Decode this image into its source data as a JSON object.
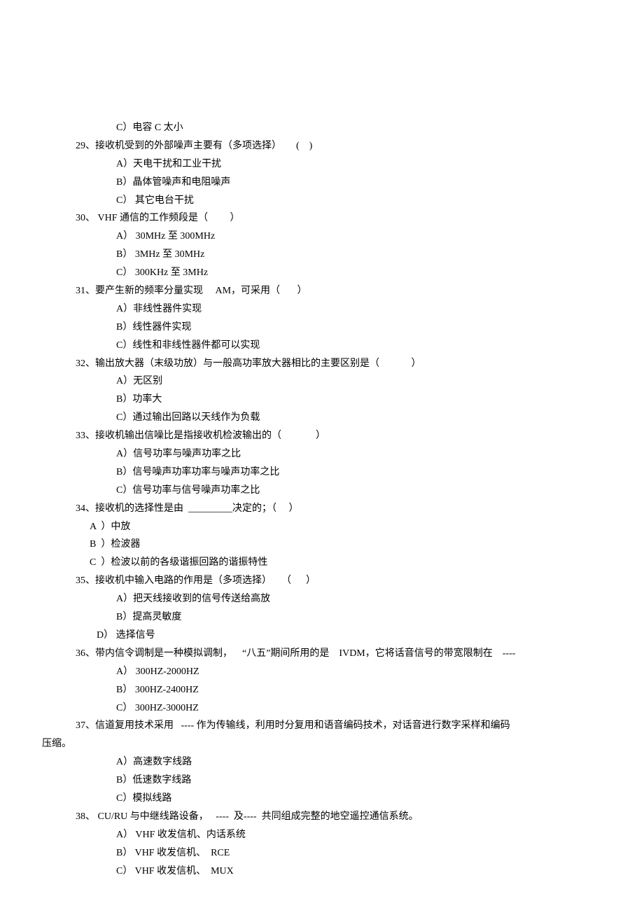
{
  "lines": [
    {
      "cls": "option",
      "text": "C）电容 C 太小"
    },
    {
      "cls": "question",
      "text": "29、接收机受到的外部噪声主要有（多项选择）      (    )"
    },
    {
      "cls": "option",
      "text": "A）天电干扰和工业干扰"
    },
    {
      "cls": "option",
      "text": "B）晶体管噪声和电阻噪声"
    },
    {
      "cls": "option",
      "text": "C） 其它电台干扰"
    },
    {
      "cls": "question",
      "text": "30、 VHF 通信的工作频段是（         ）"
    },
    {
      "cls": "option",
      "text": "A） 30MHz 至 300MHz"
    },
    {
      "cls": "option",
      "text": "B） 3MHz 至 30MHz"
    },
    {
      "cls": "option",
      "text": "C） 300KHz 至 3MHz"
    },
    {
      "cls": "question",
      "text": "31、要产生新的频率分量实现     AM，可采用（       ）"
    },
    {
      "cls": "option",
      "text": "A）非线性器件实现"
    },
    {
      "cls": "option",
      "text": "B）线性器件实现"
    },
    {
      "cls": "option",
      "text": "C）线性和非线性器件都可以实现"
    },
    {
      "cls": "question",
      "text": "32、输出放大器（末级功放）与一般高功率放大器相比的主要区别是（             ）"
    },
    {
      "cls": "option",
      "text": "A）无区别"
    },
    {
      "cls": "option",
      "text": "B）功率大"
    },
    {
      "cls": "option",
      "text": "C）通过输出回路以天线作为负载"
    },
    {
      "cls": "question",
      "text": "33、接收机输出信噪比是指接收机检波输出的（              ）"
    },
    {
      "cls": "option",
      "text": "A）信号功率与噪声功率之比"
    },
    {
      "cls": "option",
      "text": "B）信号噪声功率功率与噪声功率之比"
    },
    {
      "cls": "option",
      "text": "C）信号功率与信号噪声功率之比"
    },
    {
      "cls": "question",
      "text": "34、接收机的选择性是由  _________决定的；（     ）"
    },
    {
      "cls": "option near",
      "text": "A  ）中放"
    },
    {
      "cls": "option near",
      "text": "B  ）检波器"
    },
    {
      "cls": "option near",
      "text": "C  ）检波以前的各级谐振回路的谐振特性"
    },
    {
      "cls": "question",
      "text": "35、接收机中输入电路的作用是（多项选择）    （      ）"
    },
    {
      "cls": "option",
      "text": "A）把天线接收到的信号传送给高放"
    },
    {
      "cls": "option",
      "text": "B）提高灵敏度"
    },
    {
      "cls": "option nearer",
      "text": "D） 选择信号"
    },
    {
      "cls": "question",
      "text": "36、带内信令调制是一种模拟调制，    “八五”期间所用的是    IVDM，它将话音信号的带宽限制在    ----"
    },
    {
      "cls": "option",
      "text": "A） 300HZ-2000HZ"
    },
    {
      "cls": "option",
      "text": "B） 300HZ-2400HZ"
    },
    {
      "cls": "option",
      "text": "C） 300HZ-3000HZ"
    },
    {
      "cls": "question",
      "text": "37、信道复用技术采用   ---- 作为传输线，利用时分复用和语音编码技术，对话音进行数字采样和编码"
    },
    {
      "cls": "continuation",
      "text": "压缩。"
    },
    {
      "cls": "option",
      "text": "A）高速数字线路"
    },
    {
      "cls": "option",
      "text": "B）低速数字线路"
    },
    {
      "cls": "option",
      "text": "C）模拟线路"
    },
    {
      "cls": "question",
      "text": "38、 CU/RU 与中继线路设备，   ----  及----  共同组成完整的地空遥控通信系统。"
    },
    {
      "cls": "option",
      "text": "A） VHF 收发信机、内话系统"
    },
    {
      "cls": "option",
      "text": "B） VHF 收发信机、  RCE"
    },
    {
      "cls": "option",
      "text": "C） VHF 收发信机、  MUX"
    }
  ]
}
